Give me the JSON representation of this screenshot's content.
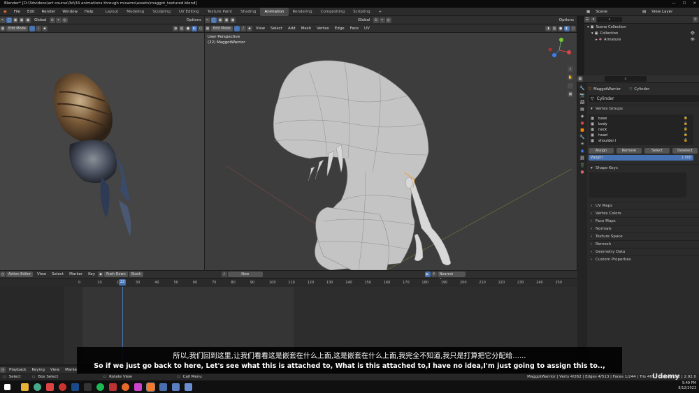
{
  "window": {
    "title": "Blender* [D:\\3dvideos\\art course\\3d\\34 animations through mixamo\\assets\\maggot_textured.blend]"
  },
  "menus": [
    "File",
    "Edit",
    "Render",
    "Window",
    "Help"
  ],
  "workspaces": [
    {
      "label": "Layout",
      "active": false
    },
    {
      "label": "Modeling",
      "active": false
    },
    {
      "label": "Sculpting",
      "active": false
    },
    {
      "label": "UV Editing",
      "active": false
    },
    {
      "label": "Texture Paint",
      "active": false
    },
    {
      "label": "Shading",
      "active": false
    },
    {
      "label": "Animation",
      "active": true
    },
    {
      "label": "Rendering",
      "active": false
    },
    {
      "label": "Compositing",
      "active": false
    },
    {
      "label": "Scripting",
      "active": false
    }
  ],
  "scene": {
    "label": "Scene",
    "view_layer": "View Layer"
  },
  "left_viewport": {
    "mode": "Edit Mode",
    "orientation": "Global",
    "options": "Options"
  },
  "main_viewport": {
    "mode": "Edit Mode",
    "menus": [
      "View",
      "Select",
      "Add",
      "Mesh",
      "Vertex",
      "Edge",
      "Face",
      "UV"
    ],
    "orientation": "Global",
    "options": "Options",
    "perspective": "User Perspective",
    "object_info": "(22) MaggotWarrior"
  },
  "outliner": {
    "items": [
      {
        "label": "Scene Collection",
        "indent": 0
      },
      {
        "label": "Collection",
        "indent": 1
      },
      {
        "label": "Armature",
        "indent": 2
      }
    ]
  },
  "properties": {
    "object_name": "MaggotWarrior",
    "mesh_name": "Cylinder",
    "data_field": "Cylinder",
    "vertex_groups_title": "Vertex Groups",
    "vertex_groups": [
      "base",
      "body",
      "neck",
      "head",
      "shoulder.l"
    ],
    "buttons": {
      "assign": "Assign",
      "remove": "Remove",
      "select": "Select",
      "deselect": "Deselect"
    },
    "weight_label": "Weight",
    "weight_value": "1.000",
    "shape_keys_title": "Shape Keys",
    "panels": [
      "UV Maps",
      "Vertex Colors",
      "Face Maps",
      "Normals",
      "Texture Space",
      "Remesh",
      "Geometry Data",
      "Custom Properties"
    ]
  },
  "action_editor": {
    "mode": "Action Editor",
    "menus": [
      "View",
      "Select",
      "Marker",
      "Key"
    ],
    "push_down": "Push Down",
    "stash": "Stash",
    "new_label": "New",
    "snap": "Nearest Frame",
    "current_frame": "22",
    "ticks": [
      "0",
      "10",
      "20",
      "30",
      "40",
      "50",
      "60",
      "70",
      "80",
      "90",
      "100",
      "110",
      "120",
      "130",
      "140",
      "150",
      "160",
      "170",
      "180",
      "190",
      "200",
      "210",
      "220",
      "230",
      "240",
      "250"
    ]
  },
  "playback": {
    "playback": "Playback",
    "keying": "Keying",
    "view": "View",
    "marker": "Marker"
  },
  "statusbar": {
    "left": [
      "Select",
      "Box Select",
      "Rotate View",
      "Call Menu"
    ],
    "stats": "MaggotWarrior | Verts 4/262 | Edges 4/513 | Faces 1/244 | Tris 469 | Objects 1/2 | 2.92.0"
  },
  "subtitles": {
    "zh": "所以,我们回到这里,让我们看看这是嵌套在什么上面,这是嵌套在什么上面,我完全不知道,我只是打算把它分配给......",
    "en": "So if we just go back to here, Let's see what this is attached to, What is this attached to,I have no idea,I'm just going to assign this to..,"
  },
  "watermark": "Udemy",
  "clock": {
    "time": "9:49 PM",
    "date": "8/12/2023"
  },
  "colors": {
    "accent": "#4772b3",
    "selection": "#f0a030",
    "viewport_bg": "#3d3d3d",
    "playhead": "#4772b3"
  }
}
